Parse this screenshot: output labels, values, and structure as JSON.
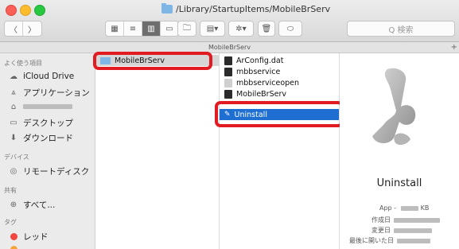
{
  "window": {
    "title": "/Library/StartupItems/MobileBrServ"
  },
  "toolbar": {
    "back_icon": "chevron-left-icon",
    "forward_icon": "chevron-right-icon",
    "view_buttons": [
      "icon-view",
      "list-view",
      "column-view",
      "cover-flow-view"
    ],
    "search_placeholder": "Q 検索"
  },
  "pathbar": {
    "label": "MobileBrServ"
  },
  "sidebar": {
    "favorites_header": "よく使う項目",
    "items": [
      {
        "label": "iCloud Drive",
        "icon": "cloud-icon"
      },
      {
        "label": "アプリケーション",
        "icon": "applications-icon"
      },
      {
        "label": "",
        "icon": "user-home-icon",
        "redacted": true
      },
      {
        "label": "デスクトップ",
        "icon": "desktop-icon"
      },
      {
        "label": "ダウンロード",
        "icon": "download-icon"
      }
    ],
    "devices_header": "デバイス",
    "devices": [
      {
        "label": "リモートディスク",
        "icon": "disc-icon"
      }
    ],
    "shared_header": "共有",
    "shared": [
      {
        "label": "すべて...",
        "icon": "globe-icon"
      }
    ],
    "tags_header": "タグ",
    "tags": [
      {
        "label": "レッド",
        "color": "#f0463f"
      }
    ]
  },
  "column1": {
    "selected": "MobileBrServ"
  },
  "column2": {
    "items": [
      "ArConfig.dat",
      "mbbservice",
      "mbbserviceopen",
      "MobileBrServ",
      "Uninstall"
    ],
    "selected": "Uninstall"
  },
  "preview": {
    "name": "Uninstall",
    "kind": "App - ",
    "size_unit": "KB",
    "labels": [
      "作成日",
      "変更日",
      "最後に開いた日"
    ]
  },
  "colors": {
    "selection_blue": "#1f6fd3",
    "highlight_red": "#e21b22"
  }
}
